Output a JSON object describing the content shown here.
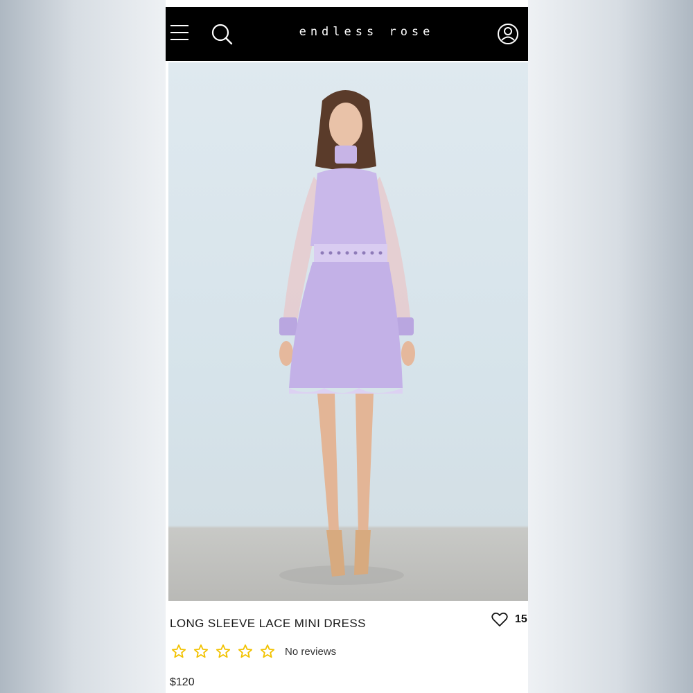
{
  "header": {
    "brand": "endless rose",
    "menu_icon": "menu-icon",
    "search_icon": "search-icon",
    "account_icon": "account-icon",
    "background_color": "#000000"
  },
  "product": {
    "title": "LONG SLEEVE LACE MINI DRESS",
    "wishlist_count": "15",
    "wishlist_icon": "heart-icon",
    "rating_stars": 0,
    "rating_max": 5,
    "star_color": "#f2c200",
    "reviews_label": "No reviews",
    "price": "$120",
    "dress_color": "#c9b8ea"
  }
}
